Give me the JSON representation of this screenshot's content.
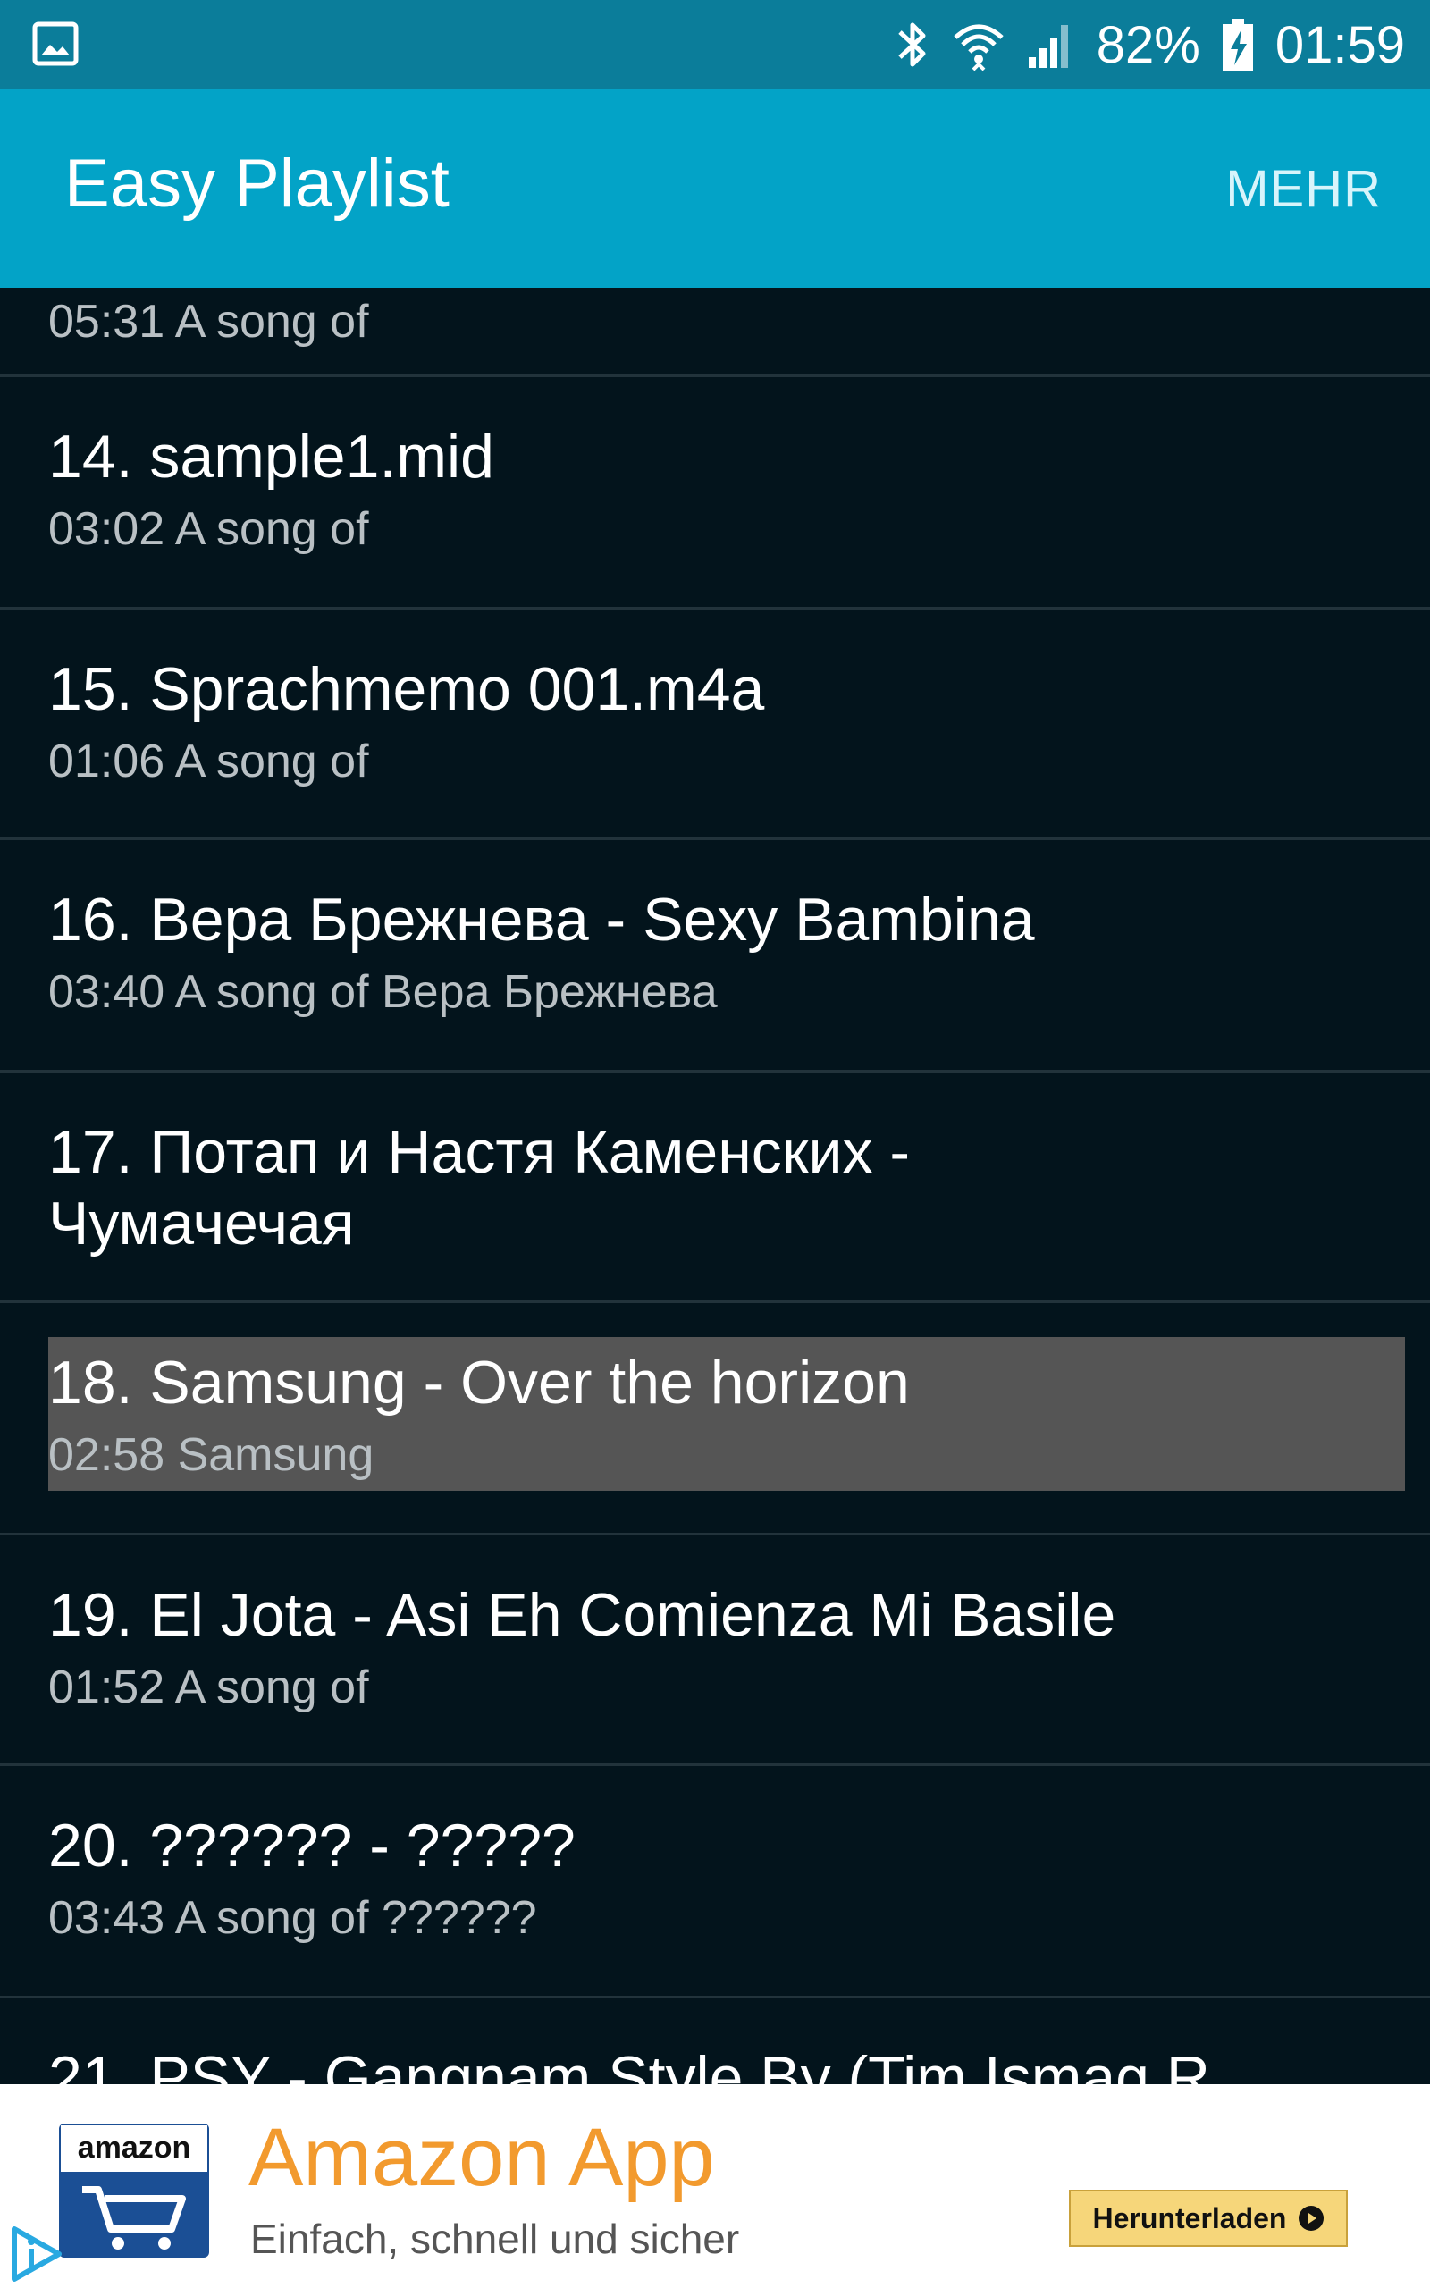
{
  "status_bar": {
    "battery": "82%",
    "time": "01:59",
    "icons": [
      "image-icon",
      "bluetooth-icon",
      "wifi-icon",
      "signal-icon",
      "battery-charging-icon"
    ]
  },
  "app_bar": {
    "title": "Easy Playlist",
    "more_label": "MEHR"
  },
  "playlist": {
    "partial_top_subtitle": "05:31 A song of",
    "items": [
      {
        "title": "14. sample1.mid",
        "subtitle": "03:02 A song of"
      },
      {
        "title": "15. Sprachmemo 001.m4a",
        "subtitle": "01:06 A song of"
      },
      {
        "title": "16. Вера Брежнева - Sexy Bambina",
        "subtitle": "03:40 A song of Вера Брежнева"
      },
      {
        "title_line1": "17. Потап и Настя Каменских -",
        "title_line2": "Чумачечая"
      },
      {
        "title": "18. Samsung - Over the horizon",
        "subtitle": "02:58 Samsung",
        "selected": true
      },
      {
        "title": "19. El Jota - Asi Eh Comienza Mi Basile",
        "subtitle": "01:52 A song of"
      },
      {
        "title": "20. ?????? - ?????",
        "subtitle": "03:43 A song of ??????"
      },
      {
        "title": "21. PSY - Gangnam Style By (Tim Ismag R"
      }
    ]
  },
  "ad": {
    "logo_text": "amazon",
    "title": "Amazon App",
    "subtitle": "Einfach, schnell und sicher",
    "button_label": "Herunterladen",
    "colors": {
      "title": "#f29a2e",
      "button": "#f6d67a",
      "logo": "#1b4f95"
    }
  },
  "colors": {
    "status_bar": "#0b7d9a",
    "app_bar": "#03a3c7",
    "background": "#03141c",
    "selected_row": "#555555"
  }
}
